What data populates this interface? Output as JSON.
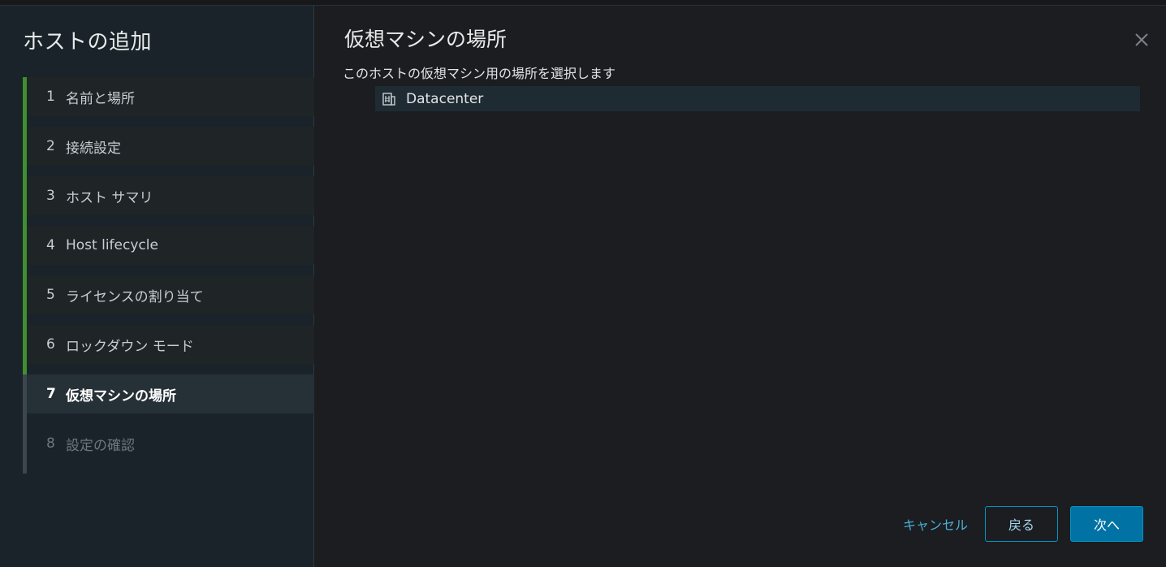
{
  "wizard": {
    "title": "ホストの追加",
    "steps": [
      {
        "num": "1",
        "label": "名前と場所",
        "state": "completed"
      },
      {
        "num": "2",
        "label": "接続設定",
        "state": "completed"
      },
      {
        "num": "3",
        "label": "ホスト サマリ",
        "state": "completed"
      },
      {
        "num": "4",
        "label": "Host lifecycle",
        "state": "completed"
      },
      {
        "num": "5",
        "label": "ライセンスの割り当て",
        "state": "completed"
      },
      {
        "num": "6",
        "label": "ロックダウン モード",
        "state": "completed"
      },
      {
        "num": "7",
        "label": "仮想マシンの場所",
        "state": "active"
      },
      {
        "num": "8",
        "label": "設定の確認",
        "state": "pending"
      }
    ]
  },
  "page": {
    "title": "仮想マシンの場所",
    "subtitle": "このホストの仮想マシン用の場所を選択します"
  },
  "tree": {
    "items": [
      {
        "label": "Datacenter",
        "icon": "datacenter-icon"
      }
    ]
  },
  "footer": {
    "cancel_label": "キャンセル",
    "back_label": "戻る",
    "next_label": "次へ"
  },
  "colors": {
    "accent": "#0072a3",
    "completed_bar": "#3f8f2f",
    "link": "#49afd9"
  }
}
